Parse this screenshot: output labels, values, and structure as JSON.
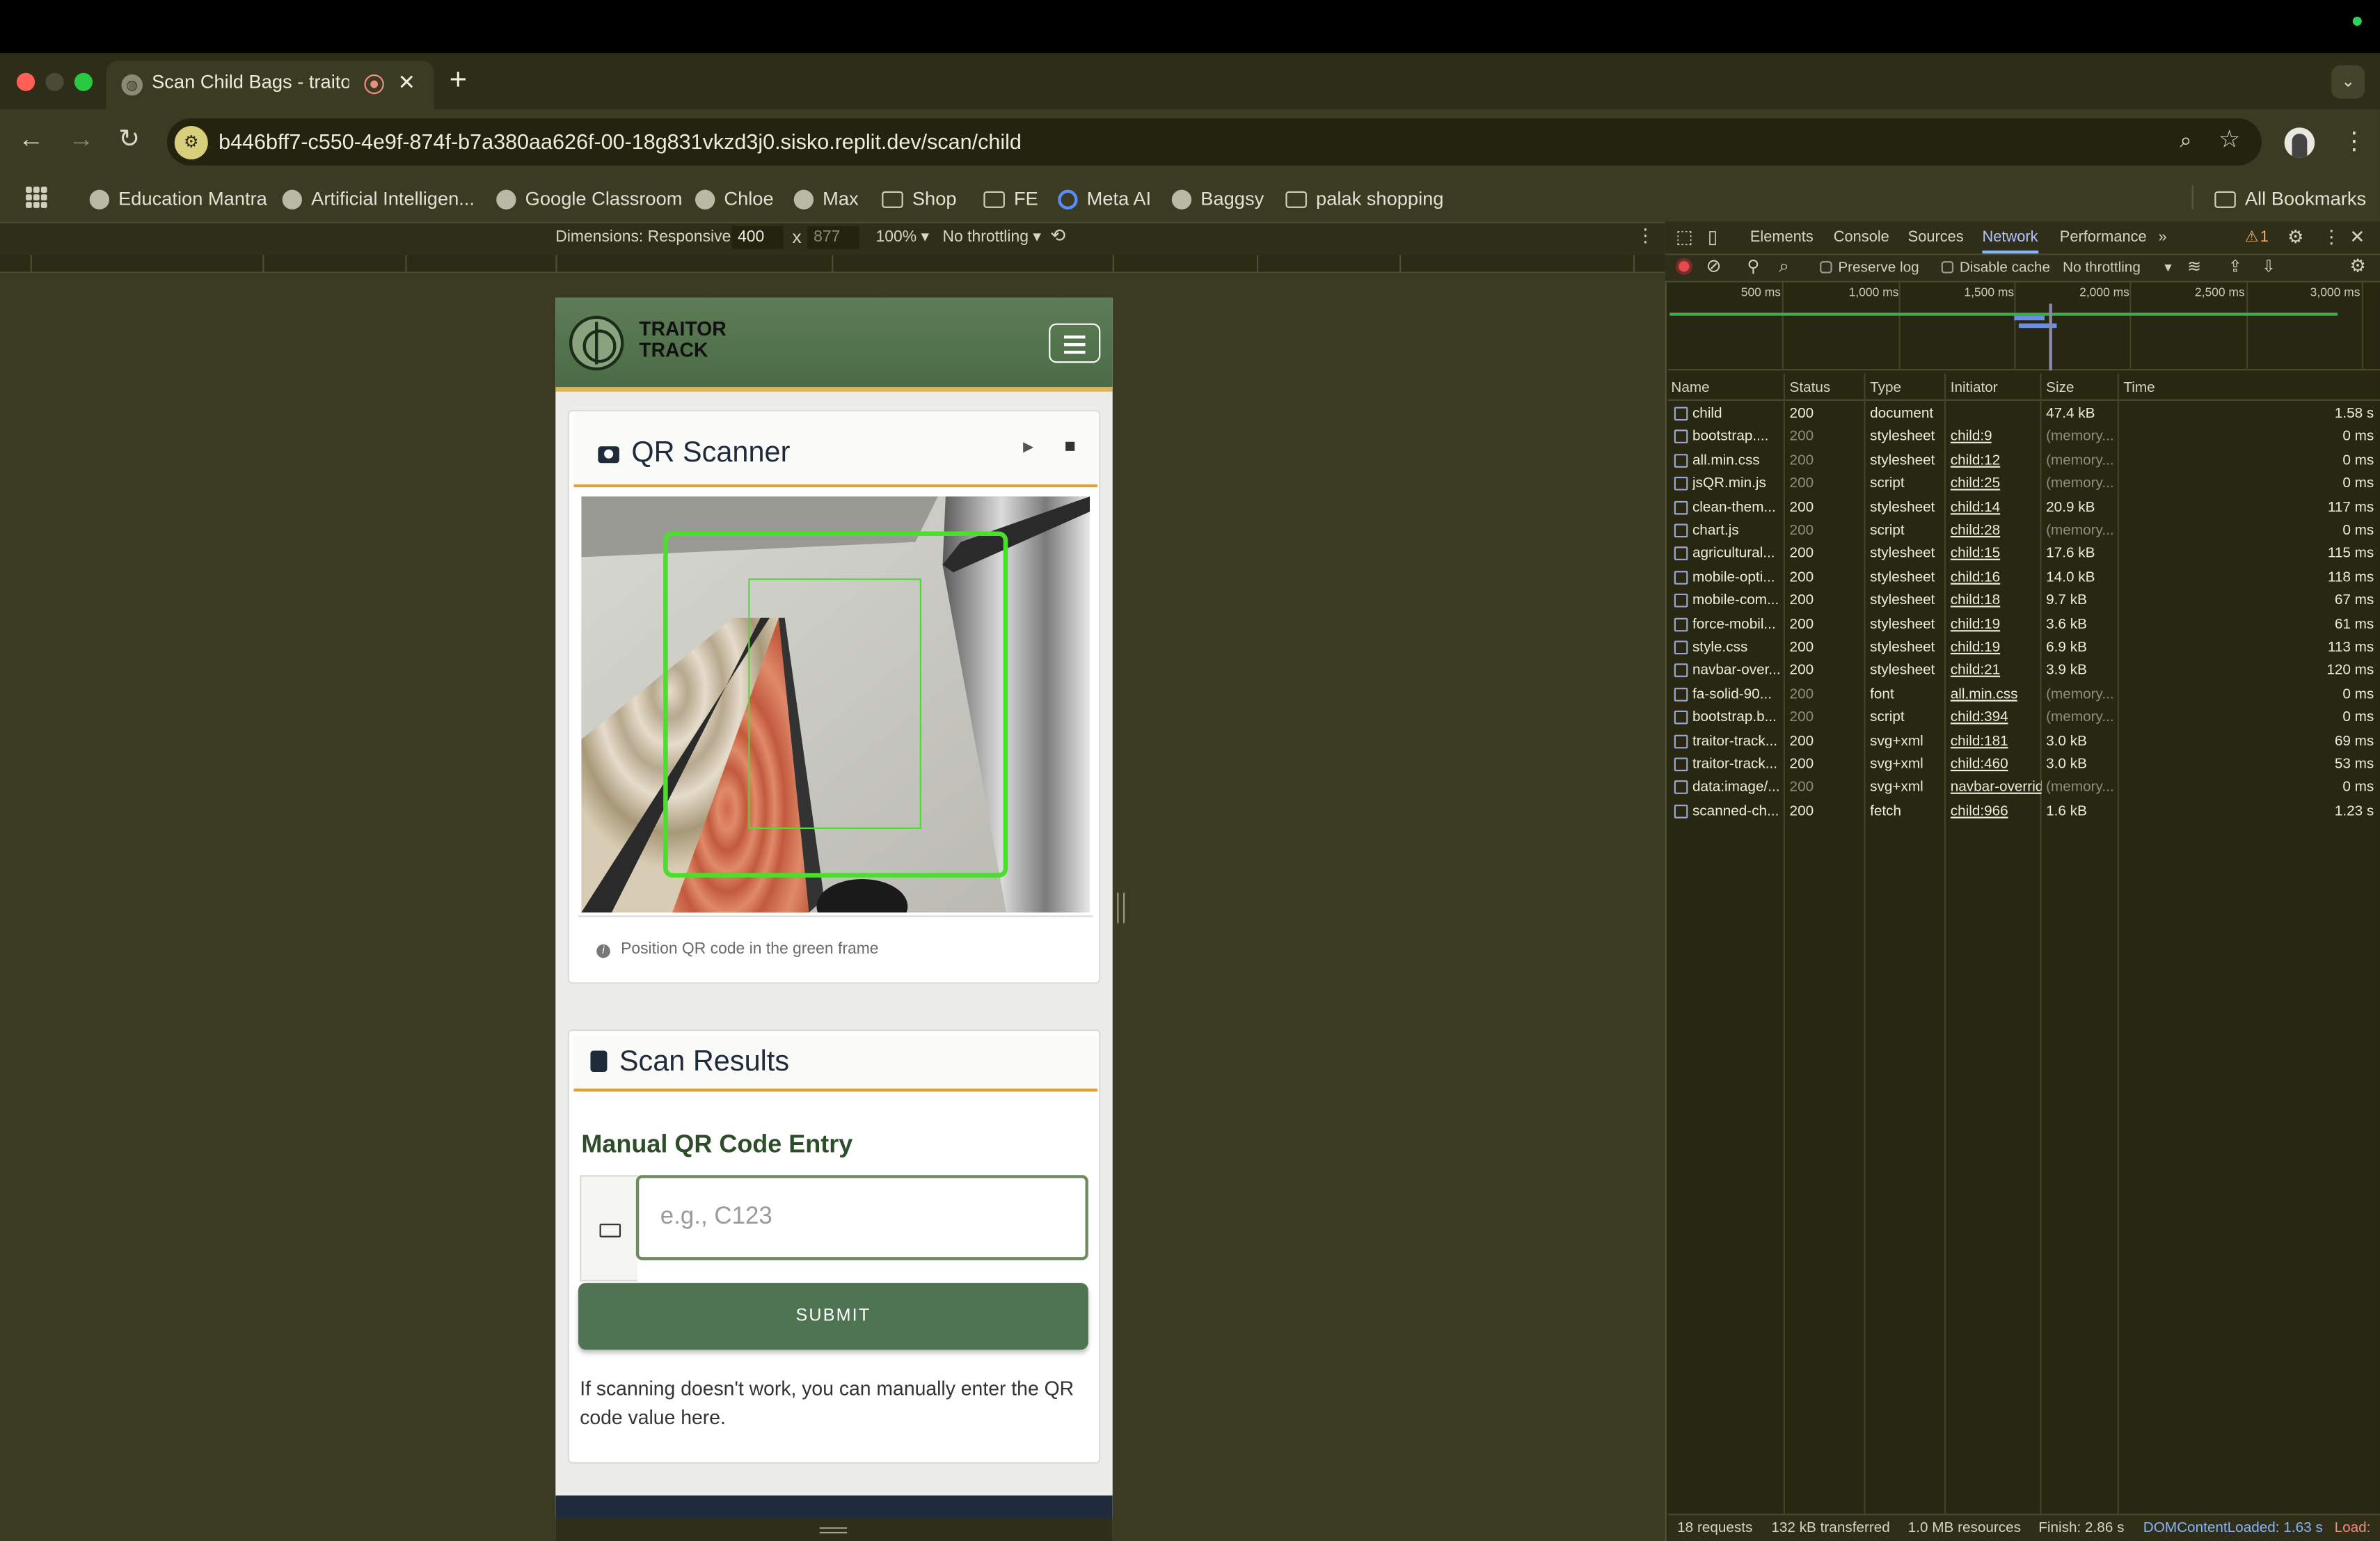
{
  "browser": {
    "tab_title": "Scan Child Bags - traitor t",
    "url": "b446bff7-c550-4e9f-874f-b7a380aa626f-00-18g831vkzd3j0.sisko.replit.dev/scan/child",
    "new_tab": "+",
    "bookmarks": [
      {
        "label": "Education Mantra",
        "icon": "globe-icon"
      },
      {
        "label": "Artificial Intelligen...",
        "icon": "globe-icon"
      },
      {
        "label": "Google Classroom",
        "icon": "globe-icon"
      },
      {
        "label": "Chloe",
        "icon": "globe-icon"
      },
      {
        "label": "Max",
        "icon": "globe-icon"
      },
      {
        "label": "Shop",
        "icon": "folder-icon"
      },
      {
        "label": "FE",
        "icon": "folder-icon"
      },
      {
        "label": "Meta AI",
        "icon": "meta-icon"
      },
      {
        "label": "Baggsy",
        "icon": "globe-icon"
      },
      {
        "label": "palak shopping",
        "icon": "folder-icon"
      }
    ],
    "all_bookmarks": "All Bookmarks"
  },
  "device_toolbar": {
    "dimensions_label": "Dimensions: Responsive ▾",
    "width": "400",
    "times": "x",
    "height": "877",
    "zoom": "100% ▾",
    "throttling": "No throttling ▾"
  },
  "app": {
    "brand_line1": "TRAITOR",
    "brand_line2": "TRACK",
    "qr_title": "QR Scanner",
    "play": "▶",
    "hint": "Position QR code in the green frame",
    "results_title": "Scan Results",
    "manual_title": "Manual QR Code Entry",
    "input_placeholder": "e.g., C123",
    "submit_label": "SUBMIT",
    "help_text": "If scanning doesn't work, you can manually enter the QR code value here."
  },
  "devtools": {
    "tabs": [
      "Elements",
      "Console",
      "Sources",
      "Network",
      "Performance"
    ],
    "more_tabs": "»",
    "warnings": "1",
    "preserve_log": "Preserve log",
    "disable_cache": "Disable cache",
    "throttling": "No throttling",
    "ticks": [
      "500 ms",
      "1,000 ms",
      "1,500 ms",
      "2,000 ms",
      "2,500 ms",
      "3,000 ms"
    ],
    "columns": [
      "Name",
      "Status",
      "Type",
      "Initiator",
      "Size",
      "Time"
    ],
    "rows": [
      {
        "name": "child",
        "status": "200",
        "type": "document",
        "initiator": "",
        "size": "47.4 kB",
        "time": "1.58 s"
      },
      {
        "name": "bootstrap....",
        "status": "200",
        "type": "stylesheet",
        "initiator": "child:9",
        "size": "(memory...",
        "time": "0 ms"
      },
      {
        "name": "all.min.css",
        "status": "200",
        "type": "stylesheet",
        "initiator": "child:12",
        "size": "(memory...",
        "time": "0 ms"
      },
      {
        "name": "jsQR.min.js",
        "status": "200",
        "type": "script",
        "initiator": "child:25",
        "size": "(memory...",
        "time": "0 ms"
      },
      {
        "name": "clean-them...",
        "status": "200",
        "type": "stylesheet",
        "initiator": "child:14",
        "size": "20.9 kB",
        "time": "117 ms"
      },
      {
        "name": "chart.js",
        "status": "200",
        "type": "script",
        "initiator": "child:28",
        "size": "(memory...",
        "time": "0 ms"
      },
      {
        "name": "agricultural...",
        "status": "200",
        "type": "stylesheet",
        "initiator": "child:15",
        "size": "17.6 kB",
        "time": "115 ms"
      },
      {
        "name": "mobile-opti...",
        "status": "200",
        "type": "stylesheet",
        "initiator": "child:16",
        "size": "14.0 kB",
        "time": "118 ms"
      },
      {
        "name": "mobile-com...",
        "status": "200",
        "type": "stylesheet",
        "initiator": "child:18",
        "size": "9.7 kB",
        "time": "67 ms"
      },
      {
        "name": "force-mobil...",
        "status": "200",
        "type": "stylesheet",
        "initiator": "child:19",
        "size": "3.6 kB",
        "time": "61 ms"
      },
      {
        "name": "style.css",
        "status": "200",
        "type": "stylesheet",
        "initiator": "child:19",
        "size": "6.9 kB",
        "time": "113 ms"
      },
      {
        "name": "navbar-over...",
        "status": "200",
        "type": "stylesheet",
        "initiator": "child:21",
        "size": "3.9 kB",
        "time": "120 ms"
      },
      {
        "name": "fa-solid-90...",
        "status": "200",
        "type": "font",
        "initiator": "all.min.css",
        "size": "(memory...",
        "time": "0 ms"
      },
      {
        "name": "bootstrap.b...",
        "status": "200",
        "type": "script",
        "initiator": "child:394",
        "size": "(memory...",
        "time": "0 ms"
      },
      {
        "name": "traitor-track...",
        "status": "200",
        "type": "svg+xml",
        "initiator": "child:181",
        "size": "3.0 kB",
        "time": "69 ms"
      },
      {
        "name": "traitor-track...",
        "status": "200",
        "type": "svg+xml",
        "initiator": "child:460",
        "size": "3.0 kB",
        "time": "53 ms"
      },
      {
        "name": "data:image/...",
        "status": "200",
        "type": "svg+xml",
        "initiator": "navbar-overrid",
        "size": "(memory...",
        "time": "0 ms"
      },
      {
        "name": "scanned-ch...",
        "status": "200",
        "type": "fetch",
        "initiator": "child:966",
        "size": "1.6 kB",
        "time": "1.23 s"
      }
    ],
    "status": {
      "requests": "18 requests",
      "transferred": "132 kB transferred",
      "resources": "1.0 MB resources",
      "finish": "Finish: 2.86 s",
      "dcl": "DOMContentLoaded: 1.63 s",
      "load": "Load:"
    }
  }
}
